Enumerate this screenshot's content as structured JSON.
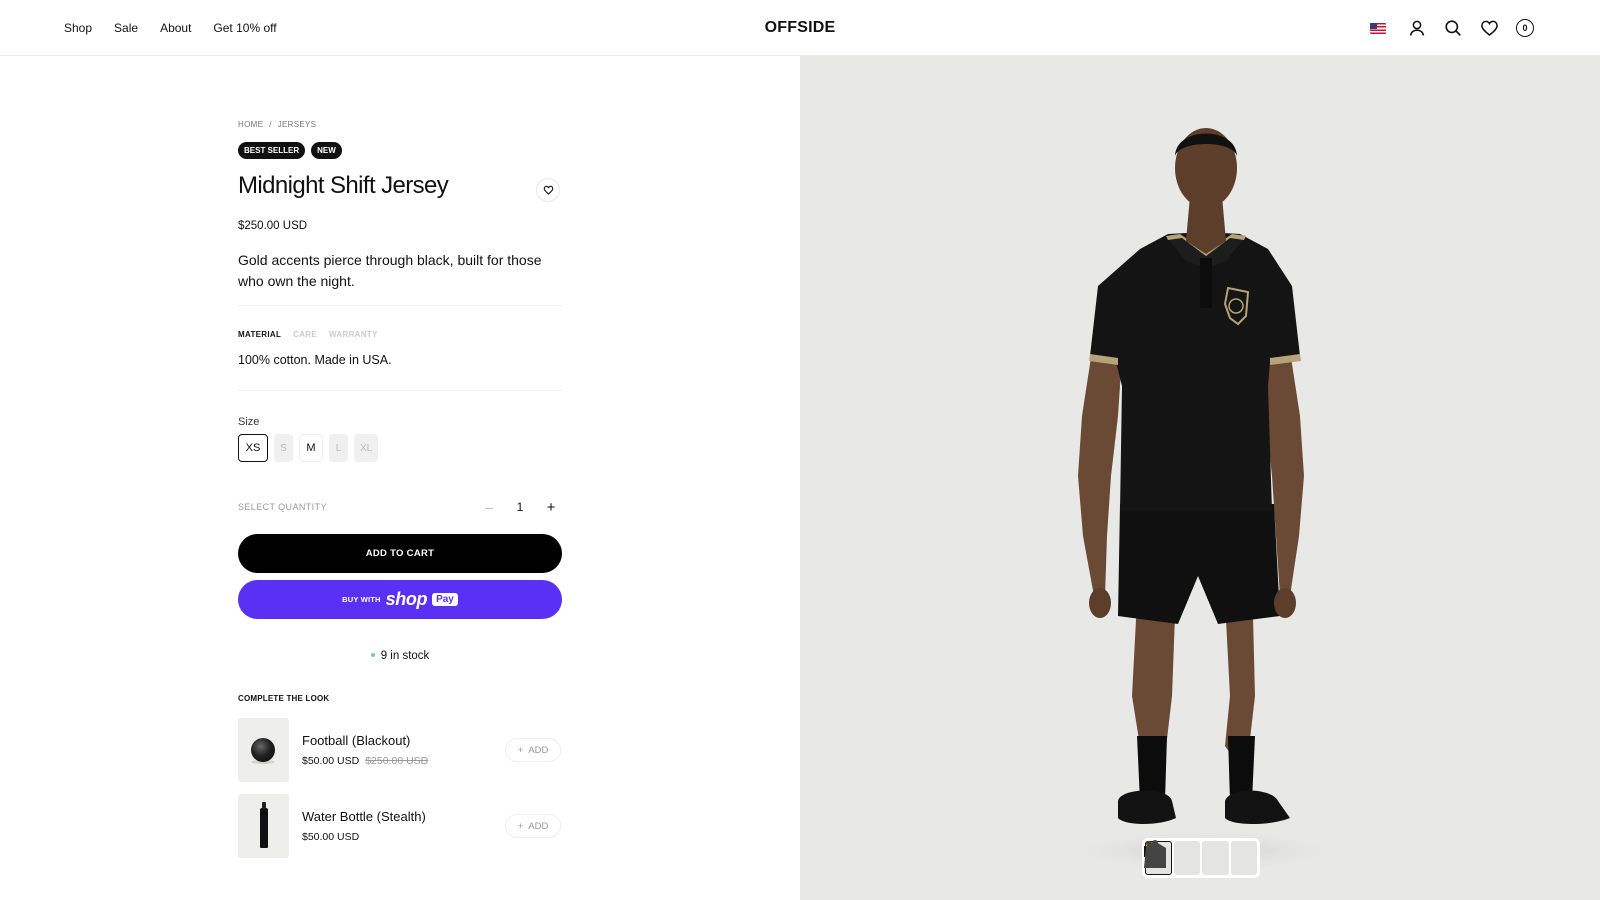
{
  "header": {
    "nav": [
      {
        "label": "Shop"
      },
      {
        "label": "Sale"
      },
      {
        "label": "About"
      },
      {
        "label": "Get 10% off"
      }
    ],
    "logo": "OFFSIDE",
    "icons": [
      "us-flag-icon",
      "account-icon",
      "search-icon",
      "heart-icon",
      "cart-icon"
    ],
    "cart_count": "0"
  },
  "breadcrumb": [
    "HOME",
    "/",
    "JERSEYS"
  ],
  "badges": [
    "BEST SELLER",
    "NEW"
  ],
  "product": {
    "title": "Midnight Shift Jersey",
    "price": "$250.00 USD",
    "description": "Gold accents pierce through black, built for those who own the night."
  },
  "info_tabs": {
    "tabs": [
      {
        "label": "MATERIAL",
        "active": true
      },
      {
        "label": "CARE",
        "active": false
      },
      {
        "label": "WARRANTY",
        "active": false
      }
    ],
    "content": "100% cotton. Made in USA."
  },
  "size": {
    "label": "Size",
    "options": [
      {
        "label": "XS",
        "state": "selected"
      },
      {
        "label": "S",
        "state": "disabled"
      },
      {
        "label": "M",
        "state": "available"
      },
      {
        "label": "L",
        "state": "disabled"
      },
      {
        "label": "XL",
        "state": "disabled"
      }
    ]
  },
  "quantity": {
    "label": "SELECT QUANTITY",
    "minus": "–",
    "value": "1",
    "plus": "+"
  },
  "buttons": {
    "add_to_cart": "ADD TO CART",
    "buy_with": "BUY WITH",
    "shop": "shop",
    "pay": "Pay"
  },
  "stock": "9 in stock",
  "complete_the_look": {
    "heading": "COMPLETE THE LOOK",
    "items": [
      {
        "name": "Football (Blackout)",
        "price": "$50.00 USD",
        "compare_price": "$250.00 USD",
        "add": "ADD",
        "add_icon": "+"
      },
      {
        "name": "Water Bottle (Stealth)",
        "price": "$50.00 USD",
        "compare_price": "",
        "add": "ADD",
        "add_icon": "+"
      }
    ]
  },
  "gallery": {
    "thumbnail_count": 4,
    "active_index": 0
  },
  "colors": {
    "accent_shop_pay": "#5a31f4",
    "primary_button": "#000000",
    "stock_dot": "#7ac9a4",
    "hero_bg": "#e8e8e6"
  }
}
